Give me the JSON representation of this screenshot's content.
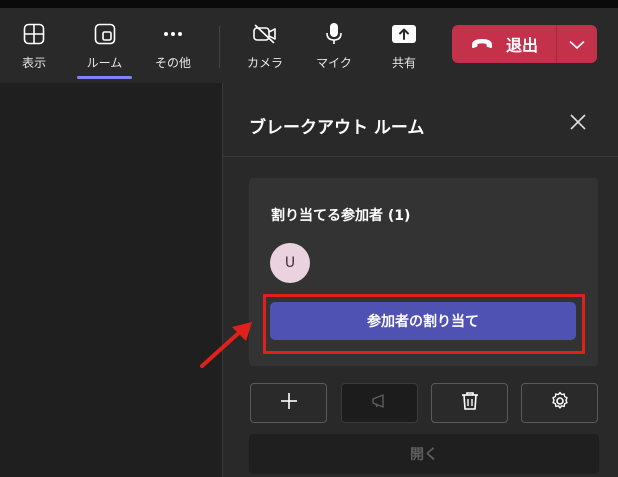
{
  "toolbar": {
    "buttons": [
      {
        "label": "表示",
        "icon": "grid-icon"
      },
      {
        "label": "ルーム",
        "icon": "rooms-icon"
      },
      {
        "label": "その他",
        "icon": "more-icon"
      },
      {
        "label": "カメラ",
        "icon": "camera-off-icon"
      },
      {
        "label": "マイク",
        "icon": "microphone-icon"
      },
      {
        "label": "共有",
        "icon": "share-icon"
      }
    ],
    "active": "ルーム",
    "leave_label": "退出",
    "leave_color": "#c4314b"
  },
  "panel": {
    "title": "ブレークアウト ルーム",
    "card": {
      "title": "割り当てる参加者 (1)",
      "participant_initial": "U",
      "assign_label": "参加者の割り当て"
    },
    "actions": [
      {
        "icon": "plus-icon",
        "enabled": true
      },
      {
        "icon": "announcement-icon",
        "enabled": false
      },
      {
        "icon": "trash-icon",
        "enabled": true
      },
      {
        "icon": "settings-icon",
        "enabled": true
      }
    ],
    "open_label": "開く"
  },
  "colors": {
    "accent": "#4f52b2",
    "highlight": "#e0201b",
    "active_underline": "#7f85f5"
  }
}
